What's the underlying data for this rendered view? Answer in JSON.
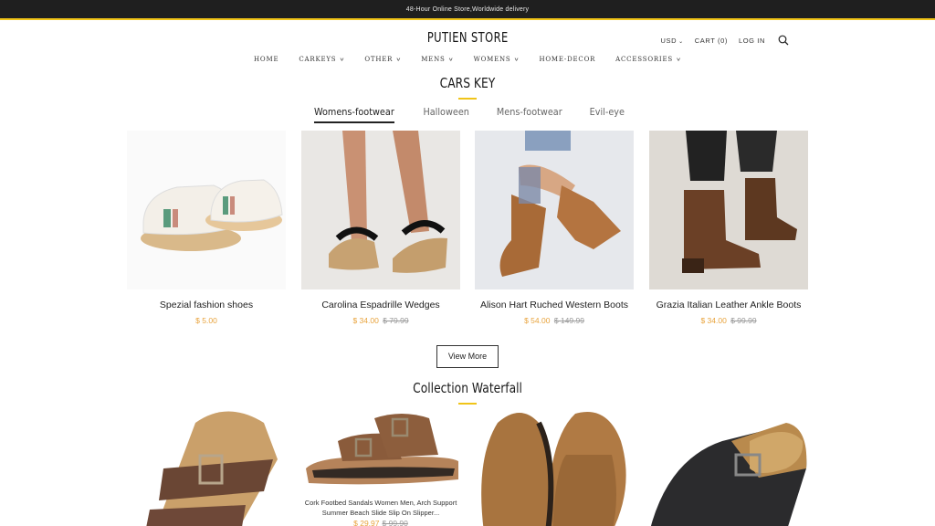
{
  "announcement": "48-Hour Online Store,Worldwide delivery",
  "store": {
    "name": "PUTIEN STORE"
  },
  "header": {
    "currency": "USD",
    "cart_label": "CART (0)",
    "login_label": "LOG IN"
  },
  "nav": [
    {
      "label": "HOME",
      "dropdown": false
    },
    {
      "label": "CARKEYS",
      "dropdown": true
    },
    {
      "label": "OTHER",
      "dropdown": true
    },
    {
      "label": "MENS",
      "dropdown": true
    },
    {
      "label": "WOMENS",
      "dropdown": true
    },
    {
      "label": "HOME-DECOR",
      "dropdown": false
    },
    {
      "label": "ACCESSORIES",
      "dropdown": true
    }
  ],
  "section1": {
    "title": "CARS KEY",
    "tabs": [
      "Womens-footwear",
      "Halloween",
      "Mens-footwear",
      "Evil-eye"
    ],
    "active_tab": "Womens-footwear",
    "products": [
      {
        "name": "Spezial fashion shoes",
        "price": "$ 5.00",
        "old_price": ""
      },
      {
        "name": "Carolina Espadrille Wedges",
        "price": "$ 34.00",
        "old_price": "$ 79.99"
      },
      {
        "name": "Alison Hart Ruched Western Boots",
        "price": "$ 54.00",
        "old_price": "$ 149.99"
      },
      {
        "name": "Grazia Italian Leather Ankle Boots",
        "price": "$ 34.00",
        "old_price": "$ 99.99"
      }
    ],
    "view_more": "View More"
  },
  "section2": {
    "title": "Collection Waterfall",
    "caption": "Cork Footbed Sandals Women Men, Arch Support Summer Beach Slide Slip On Slipper...",
    "price": "$ 29.97",
    "old_price": "$ 99.90"
  },
  "colors": {
    "accent": "#f0c419",
    "price": "#e8a33c",
    "topbar": "#1f1f1f"
  }
}
